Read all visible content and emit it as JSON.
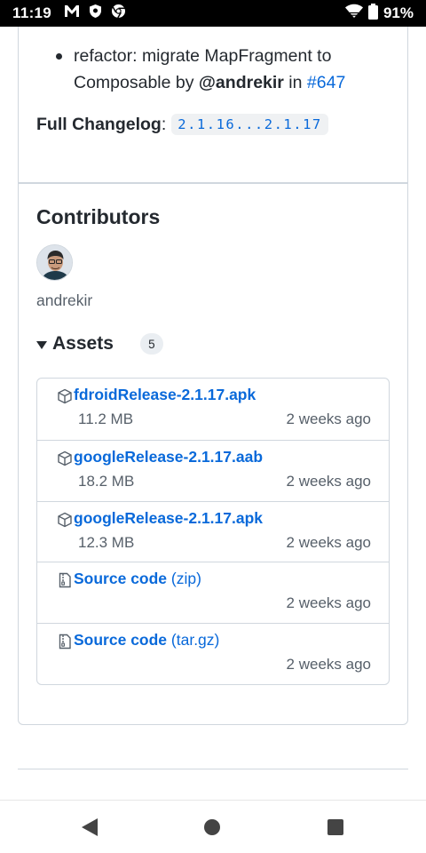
{
  "status_bar": {
    "time": "11:19",
    "notification_icons": [
      "gmail-icon",
      "shield-icon",
      "chrome-icon"
    ],
    "battery": "91%"
  },
  "release_notes": {
    "item_prefix": "refactor: migrate MapFragment to Composable by ",
    "mention": "@andrekir",
    "in_word": " in ",
    "pr_link": "#647",
    "changelog_label": "Full Changelog",
    "changelog_colon": ":",
    "changelog_range": "2.1.16...2.1.17"
  },
  "contributors": {
    "title": "Contributors",
    "name": "andrekir"
  },
  "assets": {
    "label": "Assets",
    "count": "5",
    "rows": [
      {
        "name": "fdroidRelease-2.1.17.apk",
        "ext": "",
        "size": "11.2 MB",
        "date": "2 weeks ago",
        "icon": "package-icon"
      },
      {
        "name": "googleRelease-2.1.17.aab",
        "ext": "",
        "size": "18.2 MB",
        "date": "2 weeks ago",
        "icon": "package-icon"
      },
      {
        "name": "googleRelease-2.1.17.apk",
        "ext": "",
        "size": "12.3 MB",
        "date": "2 weeks ago",
        "icon": "package-icon"
      },
      {
        "name": "Source code",
        "ext": " (zip)",
        "size": "",
        "date": "2 weeks ago",
        "icon": "file-zip-icon"
      },
      {
        "name": "Source code",
        "ext": " (tar.gz)",
        "size": "",
        "date": "2 weeks ago",
        "icon": "file-zip-icon"
      }
    ]
  },
  "colors": {
    "link": "#0969da",
    "text": "#24292f",
    "muted": "#57606a",
    "border": "#d0d7de"
  }
}
